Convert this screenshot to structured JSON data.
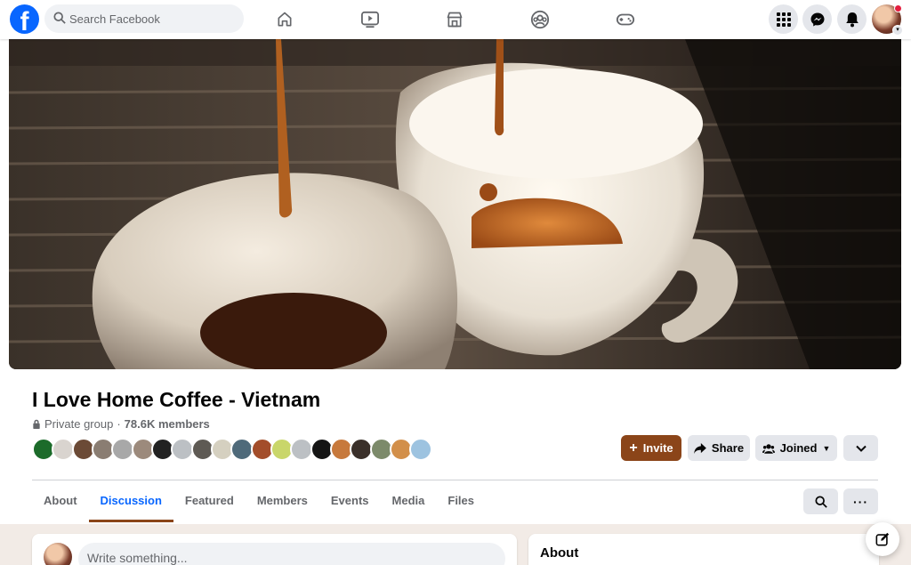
{
  "topbar": {
    "logo_letter": "f",
    "search_placeholder": "Search Facebook",
    "nav_icons": [
      "home-icon",
      "watch-icon",
      "marketplace-icon",
      "groups-icon",
      "gaming-icon"
    ],
    "right_icons": [
      "menu-grid-icon",
      "messenger-icon",
      "notifications-icon",
      "account-avatar"
    ],
    "notification_dot_color": "#e41e3f"
  },
  "group": {
    "name": "I Love Home Coffee - Vietnam",
    "privacy": "Private group",
    "separator": "·",
    "members": "78.6K members",
    "member_face_count": 20
  },
  "actions": {
    "invite": "Invite",
    "share": "Share",
    "joined": "Joined"
  },
  "tabs": [
    {
      "label": "About",
      "active": false
    },
    {
      "label": "Discussion",
      "active": true
    },
    {
      "label": "Featured",
      "active": false
    },
    {
      "label": "Members",
      "active": false
    },
    {
      "label": "Events",
      "active": false
    },
    {
      "label": "Media",
      "active": false
    },
    {
      "label": "Files",
      "active": false
    }
  ],
  "composer": {
    "placeholder": "Write something..."
  },
  "about_card": {
    "title": "About"
  },
  "colors": {
    "brand": "#0866ff",
    "accent": "#8b4519",
    "active_tab_text": "#0866ff"
  }
}
